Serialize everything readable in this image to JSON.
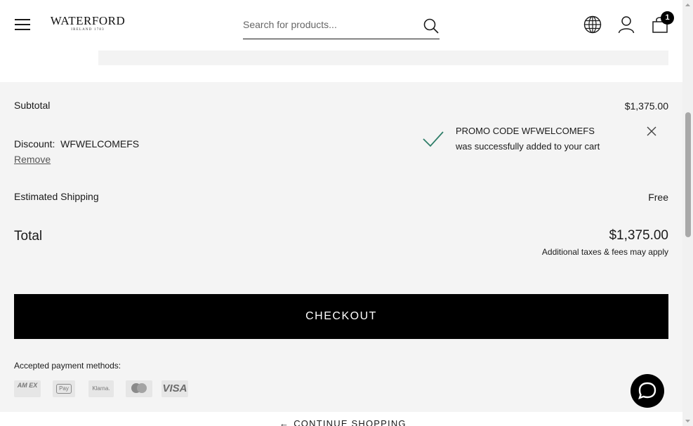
{
  "header": {
    "logo_text": "WATERFORD",
    "logo_sub": "IRELAND 1783",
    "search_placeholder": "Search for products...",
    "cart_count": "1"
  },
  "summary": {
    "subtotal_label": "Subtotal",
    "subtotal_value": "$1,375.00",
    "discount_label": "Discount:",
    "discount_code": "WFWELCOMEFS",
    "remove_label": "Remove",
    "shipping_label": "Estimated Shipping",
    "shipping_value": "Free",
    "total_label": "Total",
    "total_value": "$1,375.00",
    "taxes_note": "Additional taxes & fees may apply"
  },
  "promo_toast": {
    "line1": "PROMO CODE WFWELCOMEFS",
    "line2": "was successfully added to your cart",
    "icon": "check-icon"
  },
  "checkout": {
    "button_label": "CHECKOUT"
  },
  "payment": {
    "label": "Accepted payment methods:",
    "methods": {
      "amex": "AM EX",
      "apple_pay": "Pay",
      "klarna": "Klarna.",
      "mastercard": "mastercard",
      "visa": "VISA"
    }
  },
  "footer": {
    "continue_label": "CONTINUE SHOPPING"
  },
  "colors": {
    "accent_check": "#2e7d68",
    "button_bg": "#000000",
    "summary_bg": "#f4f4f4"
  }
}
